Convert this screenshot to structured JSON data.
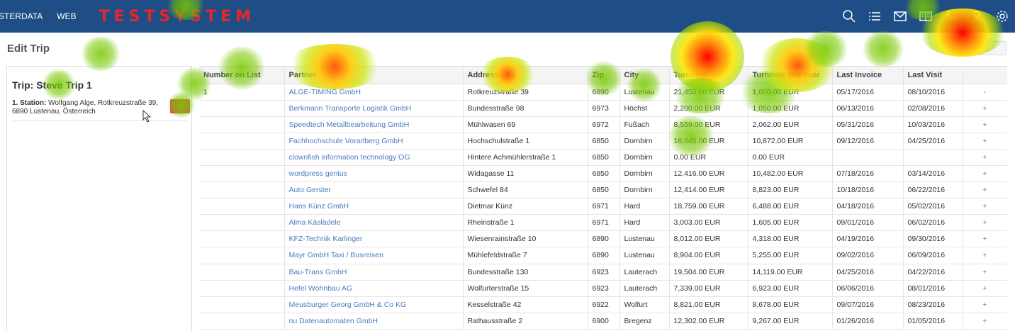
{
  "navbar": {
    "links": [
      "STERDATA",
      "WEB"
    ],
    "brand": "TESTSYSTEM",
    "icons": [
      "search-icon",
      "list-icon",
      "mail-icon",
      "book-icon",
      "phone-icon",
      "user-icon",
      "gear-icon"
    ]
  },
  "page": {
    "title": "Edit Trip"
  },
  "trip": {
    "title": "Trip: Steve Trip 1",
    "station_label": "1. Station:",
    "station_text": " Wolfgang Alge, Rotkreuzstraße 39, 6890 Lustenau, Österreich",
    "remove_label": "-"
  },
  "table": {
    "headers": [
      "Number on List",
      "Partner",
      "Address",
      "Zip",
      "City",
      "Turnover",
      "Turnover last Year",
      "Last Invoice",
      "Last Visit",
      ""
    ],
    "rows": [
      [
        "1",
        "ALGE-TIMING GmbH",
        "Rotkreuzstraße 39",
        "6890",
        "Lustenau",
        "21,450.00 EUR",
        "1,000.00 EUR",
        "05/17/2016",
        "08/10/2016",
        "-"
      ],
      [
        "",
        "Berkmann Transporte Logistik GmbH",
        "Bundesstraße 98",
        "6973",
        "Höchst",
        "2,200.00 EUR",
        "1,050.00 EUR",
        "06/13/2016",
        "02/08/2016",
        "+"
      ],
      [
        "",
        "Speedtech Metallbearbeitung GmbH",
        "Mühlwasen 69",
        "6972",
        "Fußach",
        "8,559.00 EUR",
        "2,062.00 EUR",
        "05/31/2016",
        "10/03/2016",
        "+"
      ],
      [
        "",
        "Fachhochschule Vorarlberg GmbH",
        "Hochschulstraße 1",
        "6850",
        "Dornbirn",
        "16,045.00 EUR",
        "10,872.00 EUR",
        "09/12/2016",
        "04/25/2016",
        "+"
      ],
      [
        "",
        "clownfish information technology OG",
        "Hintere Achmühlerstraße 1",
        "6850",
        "Dornbirn",
        "0.00 EUR",
        "0.00 EUR",
        "",
        "",
        "+"
      ],
      [
        "",
        "wordpress genius",
        "Widagasse 11",
        "6850",
        "Dornbirn",
        "12,416.00 EUR",
        "10,482.00 EUR",
        "07/18/2016",
        "03/14/2016",
        "+"
      ],
      [
        "",
        "Auto Gerster",
        "Schwefel 84",
        "6850",
        "Dornbirn",
        "12,414.00 EUR",
        "8,823.00 EUR",
        "10/18/2016",
        "06/22/2016",
        "+"
      ],
      [
        "",
        "Hans Künz GmbH",
        "Dietmar Künz",
        "6971",
        "Hard",
        "18,759.00 EUR",
        "6,488.00 EUR",
        "04/18/2016",
        "05/02/2016",
        "+"
      ],
      [
        "",
        "Alma Käslädele",
        "Rheinstraße 1",
        "6971",
        "Hard",
        "3,003.00 EUR",
        "1,605.00 EUR",
        "09/01/2016",
        "06/02/2016",
        "+"
      ],
      [
        "",
        "KFZ-Technik Karlinger",
        "Wiesenrainstraße 10",
        "6890",
        "Lustenau",
        "8,012.00 EUR",
        "4,318.00 EUR",
        "04/19/2016",
        "09/30/2016",
        "+"
      ],
      [
        "",
        "Mayr GmbH Taxi / Busreisen",
        "Mühlefeldstraße 7",
        "6890",
        "Lustenau",
        "8,904.00 EUR",
        "5,255.00 EUR",
        "09/02/2016",
        "06/09/2016",
        "+"
      ],
      [
        "",
        "Bau-Trans GmbH",
        "Bundesstraße 130",
        "6923",
        "Lauterach",
        "19,504.00 EUR",
        "14,119.00 EUR",
        "04/25/2016",
        "04/22/2016",
        "+"
      ],
      [
        "",
        "Hefel Wohnbau AG",
        "Wolfurterstraße 15",
        "6923",
        "Lauterach",
        "7,339.00 EUR",
        "6,923.00 EUR",
        "06/06/2016",
        "08/01/2016",
        "+"
      ],
      [
        "",
        "Meusburger Georg GmbH & Co KG",
        "Kesselstraße 42",
        "6922",
        "Wolfurt",
        "8,821.00 EUR",
        "8,678.00 EUR",
        "09/07/2016",
        "08/23/2016",
        "+"
      ],
      [
        "",
        "nu Datenautomaten GmbH",
        "Rathausstraße 2",
        "6900",
        "Bregenz",
        "12,302.00 EUR",
        "9,267.00 EUR",
        "01/26/2016",
        "01/05/2016",
        "+"
      ]
    ]
  },
  "colors": {
    "navbar": "#1f4e86",
    "brand": "#e8262a",
    "link": "#4a7dbd",
    "remove": "#d9534f"
  }
}
